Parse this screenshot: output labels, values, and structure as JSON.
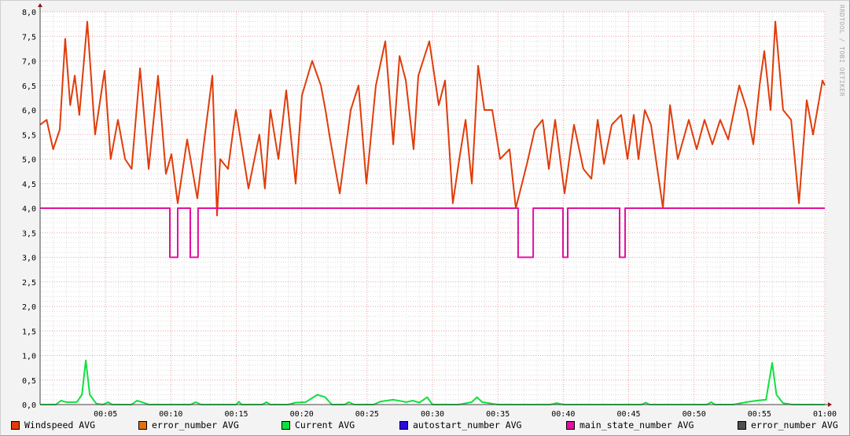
{
  "chart_data": {
    "type": "line",
    "title": "",
    "xlabel": "",
    "ylabel": "",
    "xlim_minutes": [
      0,
      60
    ],
    "ylim": [
      0,
      8
    ],
    "grid": true,
    "y_ticks": [
      "0,0",
      "0,5",
      "1,0",
      "1,5",
      "2,0",
      "2,5",
      "3,0",
      "3,5",
      "4,0",
      "4,5",
      "5,0",
      "5,5",
      "6,0",
      "6,5",
      "7,0",
      "7,5",
      "8,0"
    ],
    "x_ticks": [
      {
        "minute": 5,
        "label": "00:05"
      },
      {
        "minute": 10,
        "label": "00:10"
      },
      {
        "minute": 15,
        "label": "00:15"
      },
      {
        "minute": 20,
        "label": "00:20"
      },
      {
        "minute": 25,
        "label": "00:25"
      },
      {
        "minute": 30,
        "label": "00:30"
      },
      {
        "minute": 35,
        "label": "00:35"
      },
      {
        "minute": 40,
        "label": "00:40"
      },
      {
        "minute": 45,
        "label": "00:45"
      },
      {
        "minute": 50,
        "label": "00:50"
      },
      {
        "minute": 55,
        "label": "00:55"
      },
      {
        "minute": 60,
        "label": "01:00"
      }
    ],
    "series": [
      {
        "name": "Windspeed AVG",
        "color": "#e03c0a",
        "step": false,
        "x": [
          0,
          0.5,
          1.0,
          1.5,
          1.92,
          2.3,
          2.65,
          3.0,
          3.61,
          4.2,
          4.93,
          5.4,
          5.95,
          6.5,
          7.0,
          7.64,
          8.3,
          9.02,
          9.62,
          10.04,
          10.52,
          11.24,
          12.02,
          12.51,
          13.17,
          13.53,
          13.77,
          14.37,
          14.97,
          15.93,
          16.77,
          17.19,
          17.61,
          18.22,
          18.82,
          19.54,
          20.02,
          20.8,
          21.47,
          21.82,
          22.18,
          22.91,
          23.75,
          24.35,
          24.95,
          25.67,
          26.39,
          27.0,
          27.48,
          27.96,
          28.56,
          28.92,
          29.76,
          30.48,
          30.96,
          31.56,
          32.05,
          32.53,
          33.01,
          33.49,
          33.97,
          34.57,
          35.17,
          35.89,
          36.37,
          37.22,
          37.82,
          38.42,
          38.9,
          39.38,
          40.1,
          40.82,
          41.54,
          42.15,
          42.63,
          43.11,
          43.71,
          44.43,
          44.91,
          45.39,
          45.75,
          46.23,
          46.71,
          47.62,
          48.16,
          48.76,
          49.6,
          50.2,
          50.8,
          51.4,
          52.0,
          52.61,
          53.45,
          54.05,
          54.53,
          55.01,
          55.37,
          55.85,
          56.21,
          56.81,
          57.42,
          58.02,
          58.62,
          59.1,
          59.82,
          60
        ],
        "values": [
          5.7,
          5.8,
          5.2,
          5.6,
          7.45,
          6.1,
          6.7,
          5.9,
          7.8,
          5.5,
          6.8,
          5.0,
          5.8,
          5.0,
          4.8,
          6.85,
          4.8,
          6.7,
          4.7,
          5.1,
          4.1,
          5.4,
          4.2,
          5.3,
          6.7,
          3.85,
          5.0,
          4.8,
          6.0,
          4.4,
          5.5,
          4.4,
          6.0,
          5.0,
          6.4,
          4.5,
          6.3,
          7.0,
          6.5,
          6.0,
          5.4,
          4.3,
          6.0,
          6.5,
          4.5,
          6.5,
          7.4,
          5.3,
          7.1,
          6.6,
          5.2,
          6.7,
          7.4,
          6.1,
          6.6,
          4.1,
          5.0,
          5.8,
          4.5,
          6.9,
          6.0,
          6.0,
          5.0,
          5.2,
          4.0,
          4.9,
          5.6,
          5.8,
          4.8,
          5.8,
          4.3,
          5.7,
          4.8,
          4.6,
          5.8,
          4.9,
          5.7,
          5.9,
          5.0,
          5.9,
          5.0,
          6.0,
          5.7,
          4.0,
          6.1,
          5.0,
          5.8,
          5.2,
          5.8,
          5.3,
          5.8,
          5.4,
          6.5,
          6.0,
          5.3,
          6.5,
          7.2,
          6.0,
          7.8,
          6.0,
          5.8,
          4.1,
          6.2,
          5.5,
          6.6,
          6.5
        ]
      },
      {
        "name": "error_number AVG",
        "color": "#e07010",
        "step": true,
        "x": [],
        "values": []
      },
      {
        "name": "Current AVG",
        "color": "#10e040",
        "step": false,
        "x": [
          0,
          1.2,
          1.6,
          2.0,
          2.8,
          3.2,
          3.49,
          3.8,
          4.3,
          4.8,
          5.2,
          5.5,
          7.0,
          7.4,
          7.8,
          8.3,
          11.5,
          11.9,
          12.3,
          15.0,
          15.2,
          15.4,
          17.0,
          17.3,
          17.6,
          19.0,
          19.5,
          20.3,
          21.2,
          21.8,
          22.3,
          23.3,
          23.6,
          24.0,
          25.5,
          26.0,
          27.0,
          28.0,
          28.5,
          29.0,
          29.6,
          30.0,
          31.0,
          32.0,
          33.0,
          33.4,
          33.8,
          35.0,
          39.0,
          39.5,
          40.0,
          46.0,
          46.3,
          46.6,
          51.0,
          51.3,
          51.6,
          53.0,
          54.0,
          54.8,
          55.5,
          55.97,
          56.3,
          56.8,
          57.5,
          60
        ],
        "values": [
          0,
          0,
          0.08,
          0.05,
          0.05,
          0.2,
          0.9,
          0.2,
          0.02,
          0,
          0.05,
          0,
          0,
          0.08,
          0.05,
          0,
          0,
          0.05,
          0,
          0,
          0.06,
          0,
          0,
          0.05,
          0,
          0,
          0.04,
          0.05,
          0.2,
          0.15,
          0,
          0,
          0.05,
          0,
          0,
          0.06,
          0.1,
          0.05,
          0.08,
          0.04,
          0.15,
          0,
          0,
          0,
          0.05,
          0.15,
          0.05,
          0,
          0,
          0.03,
          0,
          0,
          0.04,
          0,
          0,
          0.05,
          0,
          0,
          0.05,
          0.08,
          0.1,
          0.85,
          0.2,
          0.03,
          0,
          0
        ]
      },
      {
        "name": "autostart_number AVG",
        "color": "#2a0ae0",
        "step": true,
        "x": [],
        "values": []
      },
      {
        "name": "main_state_number AVG",
        "color": "#e010a0",
        "step": true,
        "x": [
          0,
          9.92,
          10.52,
          11.48,
          12.08,
          36.55,
          37.7,
          39.98,
          40.34,
          44.31,
          44.73,
          60
        ],
        "values": [
          4,
          3,
          4,
          3,
          4,
          3,
          4,
          3,
          4,
          3,
          4,
          4
        ]
      },
      {
        "name": "error_number AVG",
        "color": "#505050",
        "step": true,
        "x": [],
        "values": []
      }
    ],
    "legend_placement": "bottom"
  },
  "credit": "RRDTOOL / TOBI OETIKER"
}
